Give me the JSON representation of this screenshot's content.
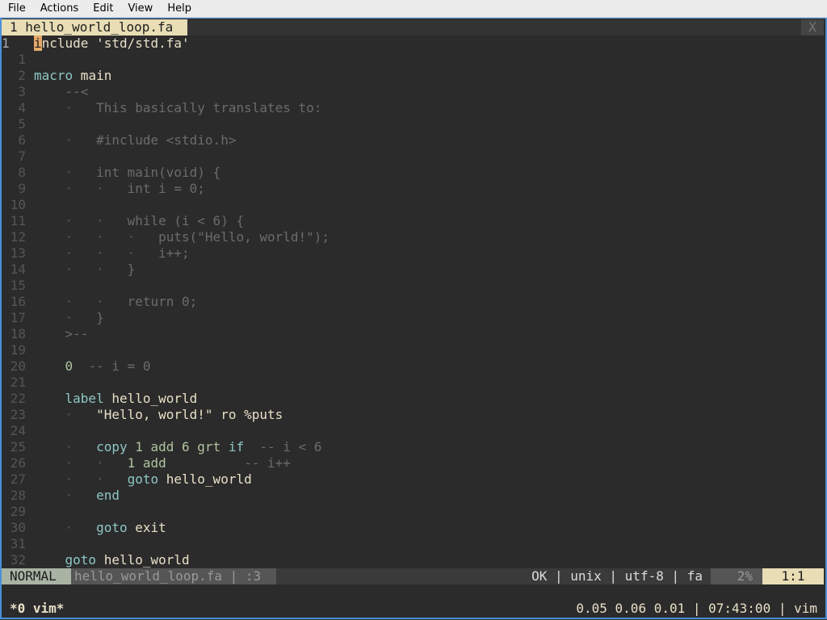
{
  "menu": {
    "items": [
      "File",
      "Actions",
      "Edit",
      "View",
      "Help"
    ]
  },
  "tabline": {
    "active_tab": "1 hello_world_loop.fa",
    "close_label": "X"
  },
  "editor": {
    "lines": [
      {
        "n": "1",
        "segs": [
          [
            "cursor",
            "i"
          ],
          [
            "id",
            "nclude 'std/std.fa'"
          ]
        ]
      },
      {
        "n": "1",
        "segs": []
      },
      {
        "n": "2",
        "segs": [
          [
            "kw",
            "macro"
          ],
          [
            "id",
            " main"
          ]
        ]
      },
      {
        "n": "3",
        "segs": [
          [
            "cm",
            "    --<"
          ]
        ]
      },
      {
        "n": "4",
        "segs": [
          [
            "dot",
            "    ·   "
          ],
          [
            "cm",
            "This basically translates to:"
          ]
        ]
      },
      {
        "n": "5",
        "segs": []
      },
      {
        "n": "6",
        "segs": [
          [
            "dot",
            "    ·   "
          ],
          [
            "cm",
            "#include <stdio.h>"
          ]
        ]
      },
      {
        "n": "7",
        "segs": []
      },
      {
        "n": "8",
        "segs": [
          [
            "dot",
            "    ·   "
          ],
          [
            "cm",
            "int main(void) {"
          ]
        ]
      },
      {
        "n": "9",
        "segs": [
          [
            "dot",
            "    ·   ·   "
          ],
          [
            "cm",
            "int i = 0;"
          ]
        ]
      },
      {
        "n": "10",
        "segs": []
      },
      {
        "n": "11",
        "segs": [
          [
            "dot",
            "    ·   ·   "
          ],
          [
            "cm",
            "while (i < 6) {"
          ]
        ]
      },
      {
        "n": "12",
        "segs": [
          [
            "dot",
            "    ·   ·   ·   "
          ],
          [
            "cm",
            "puts(\"Hello, world!\");"
          ]
        ]
      },
      {
        "n": "13",
        "segs": [
          [
            "dot",
            "    ·   ·   ·   "
          ],
          [
            "cm",
            "i++;"
          ]
        ]
      },
      {
        "n": "14",
        "segs": [
          [
            "dot",
            "    ·   ·   "
          ],
          [
            "cm",
            "}"
          ]
        ]
      },
      {
        "n": "15",
        "segs": []
      },
      {
        "n": "16",
        "segs": [
          [
            "dot",
            "    ·   ·   "
          ],
          [
            "cm",
            "return 0;"
          ]
        ]
      },
      {
        "n": "17",
        "segs": [
          [
            "dot",
            "    ·   "
          ],
          [
            "cm",
            "}"
          ]
        ]
      },
      {
        "n": "18",
        "segs": [
          [
            "cm",
            "    >--"
          ]
        ]
      },
      {
        "n": "19",
        "segs": []
      },
      {
        "n": "20",
        "segs": [
          [
            "num",
            "    0"
          ],
          [
            "cm",
            "  -- i = 0"
          ]
        ]
      },
      {
        "n": "21",
        "segs": []
      },
      {
        "n": "22",
        "segs": [
          [
            "kw",
            "    label"
          ],
          [
            "id",
            " hello_world"
          ]
        ]
      },
      {
        "n": "23",
        "segs": [
          [
            "dot",
            "    ·   "
          ],
          [
            "str",
            "\"Hello, world!\""
          ],
          [
            "id",
            " ro %puts"
          ]
        ]
      },
      {
        "n": "24",
        "segs": []
      },
      {
        "n": "25",
        "segs": [
          [
            "dot",
            "    ·   "
          ],
          [
            "kw",
            "copy"
          ],
          [
            "num",
            " 1"
          ],
          [
            "num",
            " add"
          ],
          [
            "num",
            " 6"
          ],
          [
            "num",
            " grt"
          ],
          [
            "kw",
            " if"
          ],
          [
            "cm",
            "  -- i < 6"
          ]
        ]
      },
      {
        "n": "26",
        "segs": [
          [
            "dot",
            "    ·   ·   "
          ],
          [
            "num",
            "1 add"
          ],
          [
            "cm",
            "          -- i++"
          ]
        ]
      },
      {
        "n": "27",
        "segs": [
          [
            "dot",
            "    ·   ·   "
          ],
          [
            "kw",
            "goto"
          ],
          [
            "id",
            " hello_world"
          ]
        ]
      },
      {
        "n": "28",
        "segs": [
          [
            "dot",
            "    ·   "
          ],
          [
            "kw",
            "end"
          ]
        ]
      },
      {
        "n": "29",
        "segs": []
      },
      {
        "n": "30",
        "segs": [
          [
            "dot",
            "    ·   "
          ],
          [
            "kw",
            "goto"
          ],
          [
            "id",
            " exit"
          ]
        ]
      },
      {
        "n": "31",
        "segs": []
      },
      {
        "n": "32",
        "segs": [
          [
            "kw",
            "    goto"
          ],
          [
            "id",
            " hello_world"
          ]
        ]
      }
    ]
  },
  "statusline": {
    "mode": "NORMAL",
    "file": "hello_world_loop.fa | :3",
    "right": "OK | unix | utf-8 | fa",
    "percent": "2%",
    "position": "1:1"
  },
  "tmux": {
    "left": "*0 vim*",
    "right": "0.05 0.06 0.01 | 07:43:00 | vim"
  }
}
